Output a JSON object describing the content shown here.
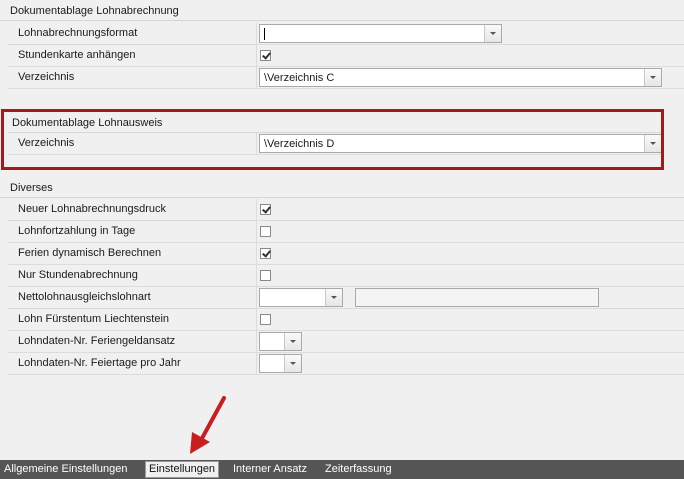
{
  "section_lohnabrechnung": {
    "title": "Dokumentablage Lohnabrechnung",
    "rows": [
      {
        "label": "Lohnabrechnungsformat",
        "value": ""
      },
      {
        "label": "Stundenkarte anhängen",
        "checked": true
      },
      {
        "label": "Verzeichnis",
        "value": "\\Verzeichnis C"
      }
    ]
  },
  "section_lohnausweis": {
    "title": "Dokumentablage Lohnausweis",
    "rows": [
      {
        "label": "Verzeichnis",
        "value": "\\Verzeichnis D"
      }
    ]
  },
  "section_diverses": {
    "title": "Diverses",
    "rows": [
      {
        "label": "Neuer Lohnabrechnungsdruck",
        "checked": true
      },
      {
        "label": "Lohnfortzahlung in Tage",
        "checked": false
      },
      {
        "label": "Ferien dynamisch Berechnen",
        "checked": true
      },
      {
        "label": "Nur Stundenabrechnung",
        "checked": false
      },
      {
        "label": "Nettolohnausgleichslohnart",
        "value": "",
        "text": ""
      },
      {
        "label": "Lohn Fürstentum Liechtenstein",
        "checked": false
      },
      {
        "label": "Lohndaten-Nr. Feriengeldansatz",
        "value": ""
      },
      {
        "label": "Lohndaten-Nr. Feiertage pro Jahr",
        "value": ""
      }
    ]
  },
  "tabs": [
    {
      "label": "Allgemeine Einstellungen",
      "active": false
    },
    {
      "label": "Einstellungen",
      "active": true
    },
    {
      "label": "Interner Ansatz",
      "active": false
    },
    {
      "label": "Zeiterfassung",
      "active": false
    }
  ],
  "highlight_color": "#a11b1b",
  "arrow_color": "#c81e1e"
}
